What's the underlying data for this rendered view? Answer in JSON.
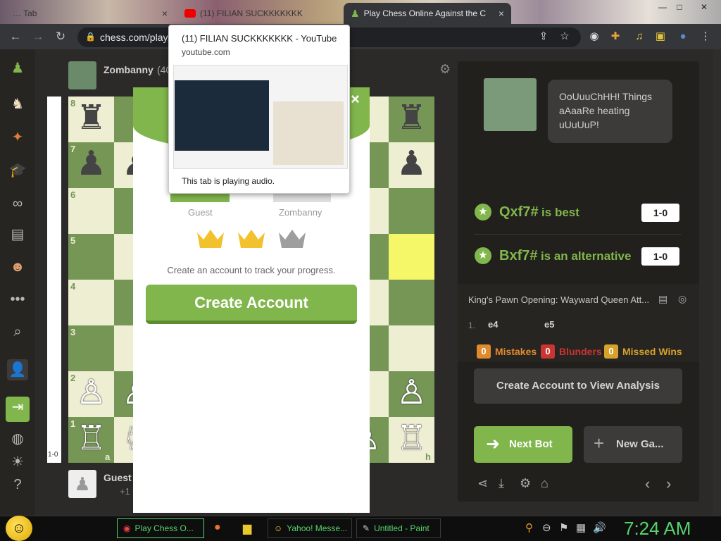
{
  "browser": {
    "tabs": [
      {
        "label": "… Tab",
        "close": "×"
      },
      {
        "label": "(11) FILIAN SUCKKKKKKK",
        "close": "×"
      },
      {
        "label": "Play Chess Online Against the C",
        "close": "×"
      }
    ],
    "url": "chess.com/play/"
  },
  "tooltip": {
    "title": "(11) FILIAN SUCKKKKKKK - YouTube",
    "domain": "youtube.com",
    "status": "This tab is playing audio."
  },
  "players": {
    "top_name": "Zombanny",
    "top_rating": "(40",
    "bottom_name": "Guest",
    "bottom_extra": "+1"
  },
  "board": {
    "ranks": [
      "8",
      "7",
      "6",
      "5",
      "4",
      "3",
      "2",
      "1"
    ],
    "files": [
      "a",
      "h"
    ],
    "eval": "1-0"
  },
  "modal": {
    "guest_label": "Guest",
    "bot_label": "Zombanny",
    "prompt": "Create an account to track your progress.",
    "create_button": "Create Account",
    "close": "×"
  },
  "bot_panel": {
    "message": "OoUuuChHH! Things aAaaRe heating uUuUuP!",
    "best_move": "Qxf7#",
    "best_text": "is best",
    "best_score": "1-0",
    "alt_move": "Bxf7#",
    "alt_text": "is an alternative",
    "alt_score": "1-0",
    "opening": "King's Pawn Opening: Wayward Queen Att...",
    "move_number": "1.",
    "white_move": "e4",
    "black_move": "e5",
    "mistakes_count": "0",
    "mistakes_label": "Mistakes",
    "blunders_count": "0",
    "blunders_label": "Blunders",
    "missed_count": "0",
    "missed_label": "Missed Wins",
    "analysis_button": "Create Account to View Analysis",
    "next_bot_button": "Next Bot",
    "new_game_button": "New Ga..."
  },
  "taskbar": {
    "items": [
      "Play Chess O...",
      "Yahoo! Messe...",
      "Untitled - Paint"
    ],
    "clock": "7:24 AM"
  },
  "colors": {
    "accent": "#81b64c",
    "light_square": "#eeeed2",
    "dark_square": "#769656",
    "highlight": "#f6f669",
    "mistakes": "#e08a2e",
    "blunders": "#ca3431",
    "missed": "#d6a22c"
  }
}
